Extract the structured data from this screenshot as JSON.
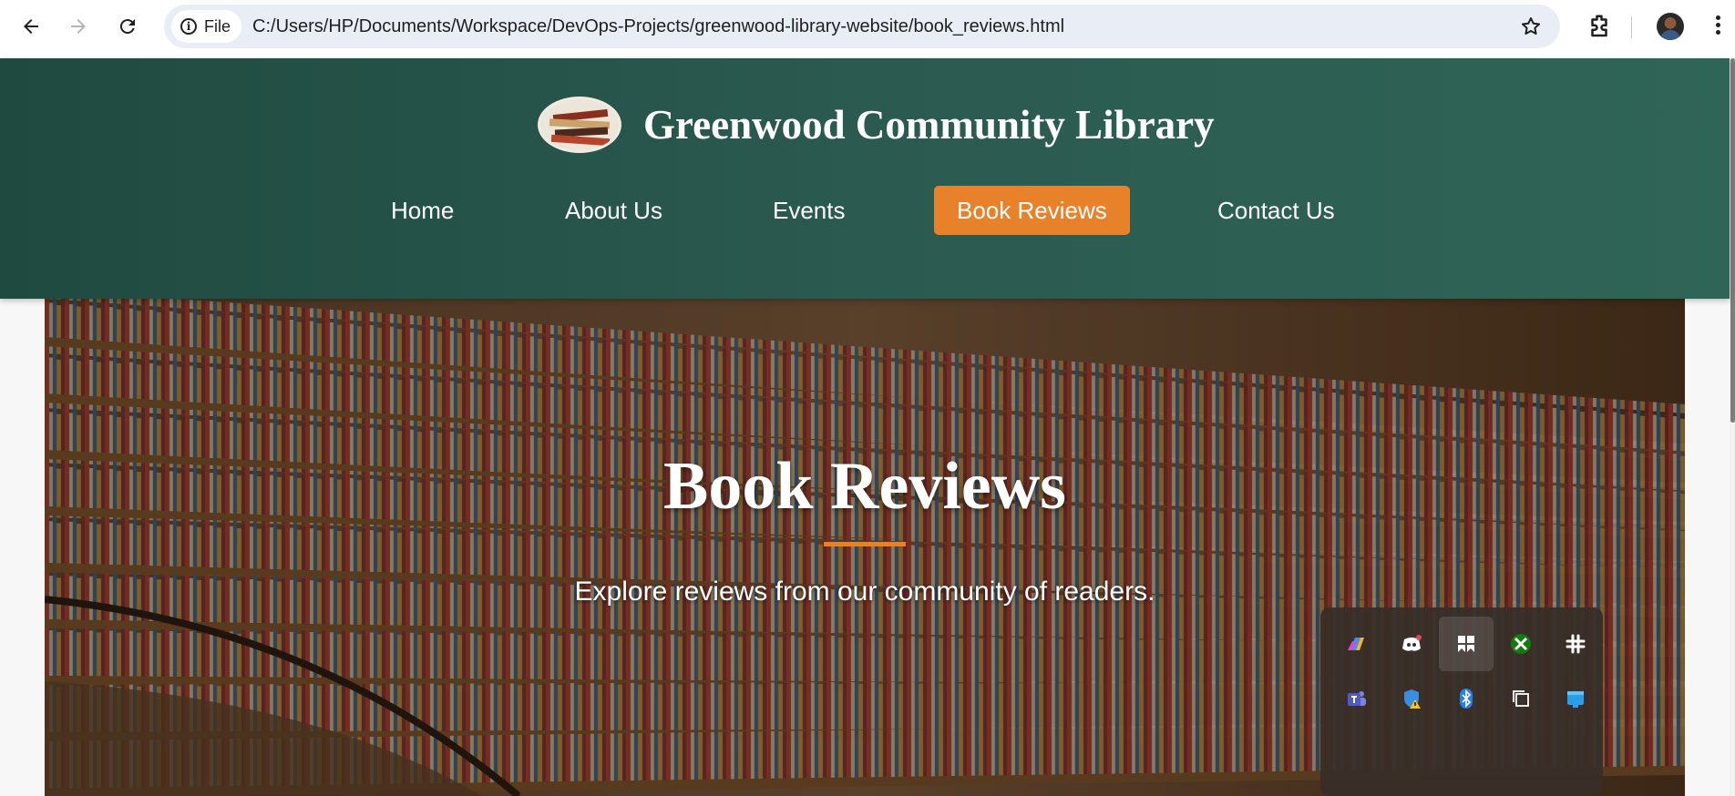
{
  "browser": {
    "site_chip_label": "File",
    "url": "C:/Users/HP/Documents/Workspace/DevOps-Projects/greenwood-library-website/book_reviews.html"
  },
  "site": {
    "title": "Greenwood Community Library",
    "nav": [
      {
        "label": "Home",
        "active": false
      },
      {
        "label": "About Us",
        "active": false
      },
      {
        "label": "Events",
        "active": false
      },
      {
        "label": "Book Reviews",
        "active": true
      },
      {
        "label": "Contact Us",
        "active": false
      }
    ]
  },
  "hero": {
    "title": "Book Reviews",
    "subtitle": "Explore reviews from our community of readers."
  },
  "tray": {
    "icons": [
      "copilot-icon",
      "discord-icon",
      "notion-icon",
      "xbox-icon",
      "slack-icon",
      "teams-icon",
      "defender-warning-icon",
      "bluetooth-icon",
      "task-view-icon",
      "app-tile-icon"
    ]
  },
  "colors": {
    "header_bg": "#2b5a50",
    "accent": "#e8822a",
    "browser_bar": "#ffffff",
    "omnibox": "#e9eef6"
  }
}
